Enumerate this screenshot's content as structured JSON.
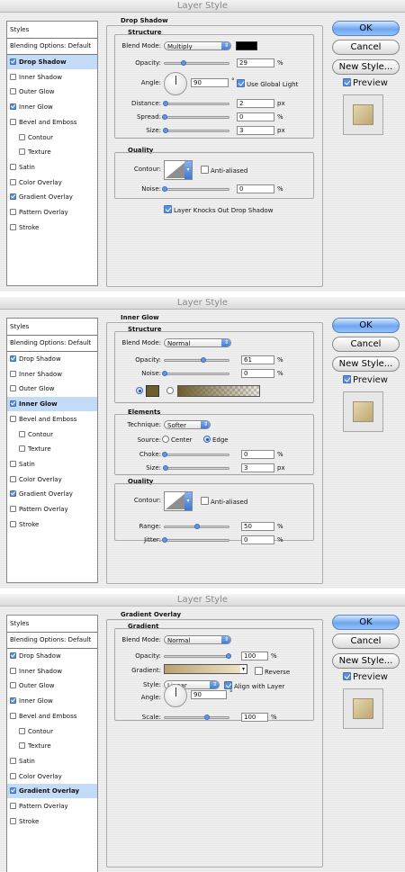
{
  "colors": {
    "drop_shadow_color": "#000000",
    "glow_color": "#6e5e2e",
    "gradient_start": "#b9a170",
    "gradient_end": "#f1e7cb",
    "preview_fill": "#cbb484",
    "selected_row": "#c4dbf7",
    "accent": "#3a78d6"
  },
  "icons": [
    "popup-arrow-icon",
    "checkbox-check-icon",
    "angle-dial-icon",
    "contour-curve-icon",
    "radio-button-icon"
  ],
  "sidebar": {
    "styles_label": "Styles",
    "blending": "Blending Options: Default",
    "items": [
      {
        "label": "Drop Shadow",
        "indent": false
      },
      {
        "label": "Inner Shadow",
        "indent": false
      },
      {
        "label": "Outer Glow",
        "indent": false
      },
      {
        "label": "Inner Glow",
        "indent": false
      },
      {
        "label": "Bevel and Emboss",
        "indent": false
      },
      {
        "label": "Contour",
        "indent": true
      },
      {
        "label": "Texture",
        "indent": true
      },
      {
        "label": "Satin",
        "indent": false
      },
      {
        "label": "Color Overlay",
        "indent": false
      },
      {
        "label": "Gradient Overlay",
        "indent": false
      },
      {
        "label": "Pattern Overlay",
        "indent": false
      },
      {
        "label": "Stroke",
        "indent": false
      }
    ],
    "checked": [
      true,
      false,
      false,
      true,
      false,
      false,
      false,
      false,
      false,
      true,
      false,
      false
    ]
  },
  "buttons": {
    "ok": "OK",
    "cancel": "Cancel",
    "new_style": "New Style...",
    "preview": "Preview",
    "preview_checked": true
  },
  "windows": [
    {
      "title": "Layer Style",
      "selected_item": 0,
      "section_title": "Drop Shadow",
      "structure": {
        "title": "Structure",
        "blend_mode_label": "Blend Mode:",
        "blend_mode": "Multiply",
        "opacity_label": "Opacity:",
        "opacity": "29",
        "opacity_level": 0.29,
        "opacity_unit": "%",
        "angle_label": "Angle:",
        "angle": "90",
        "angle_unit": "°",
        "global_light_label": "Use Global Light",
        "global_light": true,
        "distance_label": "Distance:",
        "distance": "2",
        "distance_level": 0.02,
        "distance_unit": "px",
        "spread_label": "Spread:",
        "spread": "0",
        "spread_level": 0,
        "spread_unit": "%",
        "size_label": "Size:",
        "size": "3",
        "size_level": 0.02,
        "size_unit": "px"
      },
      "quality": {
        "title": "Quality",
        "contour_label": "Contour:",
        "antialiased_label": "Anti-aliased",
        "antialiased": false,
        "noise_label": "Noise:",
        "noise": "0",
        "noise_level": 0,
        "noise_unit": "%"
      },
      "knockout_label": "Layer Knocks Out Drop Shadow",
      "knockout": true
    },
    {
      "title": "Layer Style",
      "selected_item": 3,
      "section_title": "Inner Glow",
      "structure": {
        "title": "Structure",
        "blend_mode_label": "Blend Mode:",
        "blend_mode": "Normal",
        "opacity_label": "Opacity:",
        "opacity": "61",
        "opacity_level": 0.61,
        "opacity_unit": "%",
        "noise_label": "Noise:",
        "noise": "0",
        "noise_level": 0,
        "noise_unit": "%",
        "color_radio": true,
        "gradient_radio": false
      },
      "elements": {
        "title": "Elements",
        "technique_label": "Technique:",
        "technique": "Softer",
        "source_label": "Source:",
        "source_center": "Center",
        "source_edge": "Edge",
        "source_selected": "Edge",
        "choke_label": "Choke:",
        "choke": "0",
        "choke_level": 0,
        "choke_unit": "%",
        "size_label": "Size:",
        "size": "3",
        "size_level": 0.02,
        "size_unit": "px"
      },
      "quality": {
        "title": "Quality",
        "contour_label": "Contour:",
        "antialiased_label": "Anti-aliased",
        "antialiased": false,
        "range_label": "Range:",
        "range": "50",
        "range_level": 0.5,
        "range_unit": "%",
        "jitter_label": "Jitter:",
        "jitter": "0",
        "jitter_level": 0,
        "jitter_unit": "%"
      }
    },
    {
      "title": "Layer Style",
      "selected_item": 9,
      "section_title": "Gradient Overlay",
      "gradient": {
        "title": "Gradient",
        "blend_mode_label": "Blend Mode:",
        "blend_mode": "Normal",
        "opacity_label": "Opacity:",
        "opacity": "100",
        "opacity_level": 1,
        "opacity_unit": "%",
        "gradient_label": "Gradient:",
        "reverse_label": "Reverse",
        "reverse": false,
        "style_label": "Style:",
        "style": "Linear",
        "align_label": "Align with Layer",
        "align": true,
        "angle_label": "Angle:",
        "angle": "90",
        "angle_unit": "°",
        "scale_label": "Scale:",
        "scale": "100",
        "scale_level": 0.66,
        "scale_unit": "%"
      }
    }
  ]
}
